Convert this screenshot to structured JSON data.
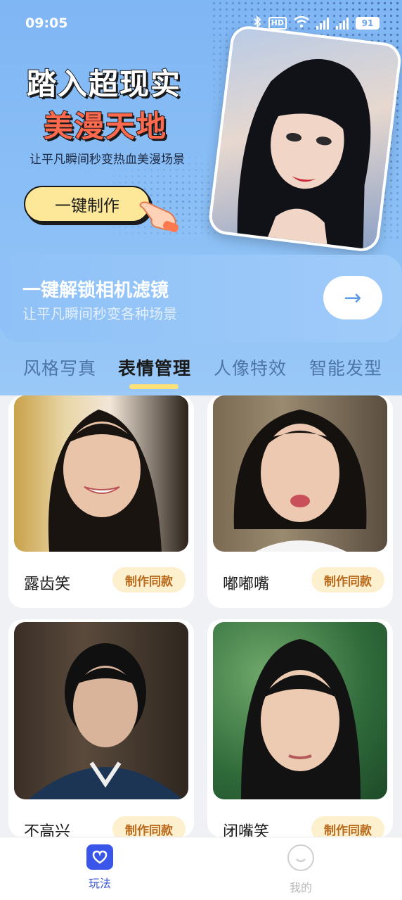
{
  "status_bar": {
    "time": "09:05",
    "hd": "HD",
    "battery": "91"
  },
  "hero": {
    "title_line1": "踏入超现实",
    "title_line2": "美漫天地",
    "subtitle": "让平凡瞬间秒变热血美漫场景",
    "make_button": "一键制作"
  },
  "unlock": {
    "title": "一键解锁相机滤镜",
    "subtitle": "让平凡瞬间秒变各种场景",
    "arrow": "→"
  },
  "tabs": [
    {
      "label": "风格写真"
    },
    {
      "label": "表情管理"
    },
    {
      "label": "人像特效"
    },
    {
      "label": "智能发型"
    }
  ],
  "cards": [
    {
      "name": "露齿笑",
      "button": "制作同款"
    },
    {
      "name": "嘟嘟嘴",
      "button": "制作同款"
    },
    {
      "name": "不高兴",
      "button": "制作同款"
    },
    {
      "name": "闭嘴笑",
      "button": "制作同款"
    }
  ],
  "nav": {
    "play": "玩法",
    "me": "我的"
  },
  "colors": {
    "accent": "#3a56e8",
    "hero_red": "#ff6a4f",
    "button_yellow": "#fde89a",
    "badge_text": "#b9691a"
  }
}
